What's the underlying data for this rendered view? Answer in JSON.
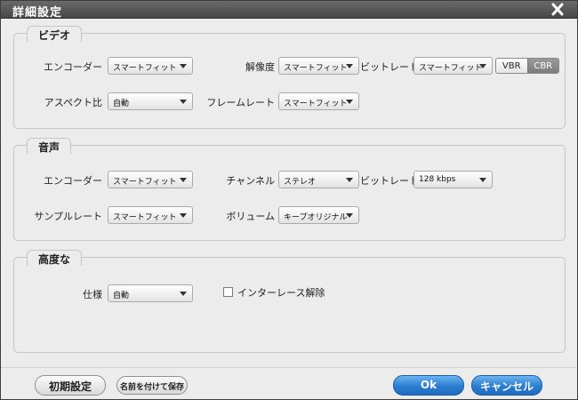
{
  "window": {
    "title": "詳細設定"
  },
  "video": {
    "legend": "ビデオ",
    "encoder": {
      "label": "エンコーダー",
      "value": "スマートフィット"
    },
    "resolution": {
      "label": "解像度",
      "value": "スマートフィット"
    },
    "bitrate": {
      "label": "ビットレート",
      "value": "スマートフィット"
    },
    "rate_mode": {
      "options": [
        "VBR",
        "CBR"
      ],
      "selected": "CBR"
    },
    "aspect": {
      "label": "アスペクト比",
      "value": "自動"
    },
    "framerate": {
      "label": "フレームレート",
      "value": "スマートフィット"
    }
  },
  "audio": {
    "legend": "音声",
    "encoder": {
      "label": "エンコーダー",
      "value": "スマートフィット"
    },
    "channel": {
      "label": "チャンネル",
      "value": "ステレオ"
    },
    "bitrate": {
      "label": "ビットレート",
      "value": "128 kbps"
    },
    "samplerate": {
      "label": "サンプルレート",
      "value": "スマートフィット"
    },
    "volume": {
      "label": "ボリューム",
      "value": "キープオリジナル"
    }
  },
  "advanced": {
    "legend": "高度な",
    "spec": {
      "label": "仕様",
      "value": "自動"
    },
    "deinterlace": {
      "label": "インターレース解除",
      "checked": false
    }
  },
  "footer": {
    "reset_label": "初期設定",
    "save_as_label": "名前を付けて保存",
    "ok_label": "Ok",
    "cancel_label": "キャンセル"
  },
  "colors": {
    "titlebar": "#555555",
    "dialog_bg": "#ececec",
    "ok_blue": "#2b7dd0",
    "segment_active": "#8a8a8a"
  }
}
